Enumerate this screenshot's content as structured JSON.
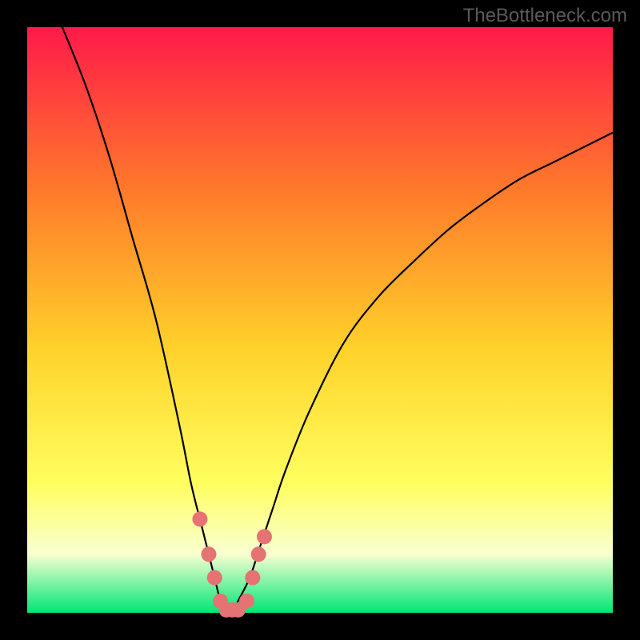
{
  "watermark": "TheBottleneck.com",
  "chart_data": {
    "type": "line",
    "title": "",
    "xlabel": "",
    "ylabel": "",
    "xlim": [
      0,
      100
    ],
    "ylim": [
      0,
      100
    ],
    "legend": false,
    "grid": false,
    "background_gradient": {
      "top": "#ff1a4a",
      "mid1": "#ff7a2a",
      "mid2": "#ffd22a",
      "mid3": "#ffff60",
      "bottom_band": "#f8ffd0",
      "bottom": "#00e676"
    },
    "series": [
      {
        "name": "curve",
        "color": "#000000",
        "x": [
          6,
          10,
          14,
          18,
          22,
          26,
          28,
          30,
          31,
          32,
          33,
          34,
          35,
          36,
          38,
          40,
          42,
          44,
          48,
          54,
          60,
          66,
          72,
          78,
          84,
          90,
          96,
          100
        ],
        "y": [
          100,
          90,
          78,
          64,
          50,
          32,
          22,
          14,
          10,
          6,
          2,
          0,
          0,
          2,
          6,
          12,
          18,
          24,
          34,
          46,
          54,
          60,
          65.5,
          70,
          74,
          77,
          80,
          82
        ]
      }
    ],
    "markers": {
      "name": "highlight-dots",
      "color": "#e57373",
      "radius": 1.3,
      "points": [
        {
          "x": 29.5,
          "y": 16
        },
        {
          "x": 31,
          "y": 10
        },
        {
          "x": 32,
          "y": 6
        },
        {
          "x": 33,
          "y": 2
        },
        {
          "x": 34,
          "y": 0.5
        },
        {
          "x": 35,
          "y": 0.5
        },
        {
          "x": 36,
          "y": 0.5
        },
        {
          "x": 37.5,
          "y": 2
        },
        {
          "x": 38.5,
          "y": 6
        },
        {
          "x": 39.5,
          "y": 10
        },
        {
          "x": 40.5,
          "y": 13
        }
      ]
    }
  }
}
